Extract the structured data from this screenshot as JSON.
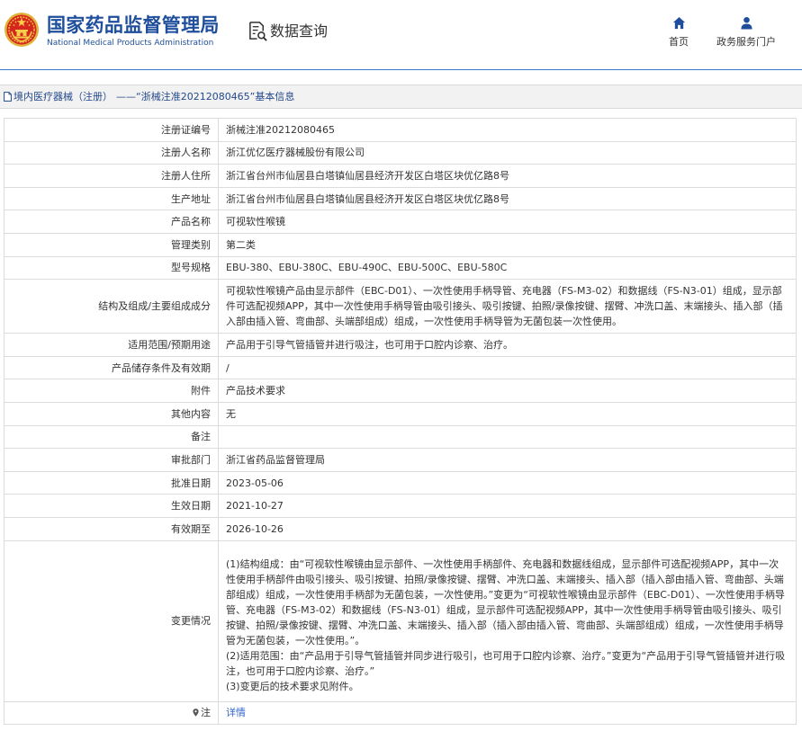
{
  "header": {
    "title": "国家药品监督管理局",
    "subtitle": "National Medical Products Administration",
    "query_label": "数据查询",
    "nav_home": "首页",
    "nav_portal": "政务服务门户",
    "brand_color": "#1f4f9c",
    "icons": [
      "national-emblem-logo",
      "search-document-icon",
      "home-icon",
      "user-icon"
    ]
  },
  "breadcrumb": {
    "icon": "document-icon",
    "category": "境内医疗器械（注册）",
    "title": "——“浙械注准20212080465”基本信息"
  },
  "record": {
    "fields": [
      {
        "label": "注册证编号",
        "value": "浙械注准20212080465"
      },
      {
        "label": "注册人名称",
        "value": "浙江优亿医疗器械股份有限公司"
      },
      {
        "label": "注册人住所",
        "value": "浙江省台州市仙居县白塔镇仙居县经济开发区白塔区块优亿路8号"
      },
      {
        "label": "生产地址",
        "value": "浙江省台州市仙居县白塔镇仙居县经济开发区白塔区块优亿路8号"
      },
      {
        "label": "产品名称",
        "value": "可视软性喉镜"
      },
      {
        "label": "管理类别",
        "value": "第二类"
      },
      {
        "label": "型号规格",
        "value": "EBU-380、EBU-380C、EBU-490C、EBU-500C、EBU-580C"
      },
      {
        "label": "结构及组成/主要组成成分",
        "value": "可视软性喉镜产品由显示部件（EBC-D01）、一次性使用手柄导管、充电器（FS-M3-02）和数据线（FS-N3-01）组成，显示部件可选配视频APP，其中一次性使用手柄导管由吸引接头、吸引按键、拍照/录像按键、摆臂、冲洗口盖、末端接头、插入部（插入部由插入管、弯曲部、头端部组成）组成，一次性使用手柄导管为无菌包装一次性使用。"
      },
      {
        "label": "适用范围/预期用途",
        "value": "产品用于引导气管插管并进行吸注，也可用于口腔内诊察、治疗。"
      },
      {
        "label": "产品储存条件及有效期",
        "value": "/"
      },
      {
        "label": "附件",
        "value": "产品技术要求"
      },
      {
        "label": "其他内容",
        "value": "无"
      },
      {
        "label": "备注",
        "value": ""
      },
      {
        "label": "审批部门",
        "value": "浙江省药品监督管理局"
      },
      {
        "label": "批准日期",
        "value": "2023-05-06"
      },
      {
        "label": "生效日期",
        "value": "2021-10-27"
      },
      {
        "label": "有效期至",
        "value": "2026-10-26"
      }
    ],
    "changes": {
      "label": "变更情况",
      "paragraphs": [
        "(1)结构组成：由“可视软性喉镜由显示部件、一次性使用手柄部件、充电器和数据线组成，显示部件可选配视频APP，其中一次性使用手柄部件由吸引接头、吸引按键、拍照/录像按键、摆臂、冲洗口盖、末端接头、插入部（插入部由插入管、弯曲部、头端部组成）组成，一次性使用手柄部为无菌包装，一次性使用。”变更为“可视软性喉镜由显示部件（EBC-D01）、一次性使用手柄导管、充电器（FS-M3-02）和数据线（FS-N3-01）组成，显示部件可选配视频APP，其中一次性使用手柄导管由吸引接头、吸引按键、拍照/录像按键、摆臂、冲洗口盖、末端接头、插入部（插入部由插入管、弯曲部、头端部组成）组成，一次性使用手柄导管为无菌包装，一次性使用。”。",
        "(2)适用范围：由“产品用于引导气管插管并同步进行吸引，也可用于口腔内诊察、治疗。”变更为“产品用于引导气管插管并进行吸注，也可用于口腔内诊察、治疗。”",
        "(3)变更后的技术要求见附件。"
      ]
    },
    "note": {
      "icon": "pin-icon",
      "label": "注",
      "link": "详情",
      "link_color": "#3366cc"
    }
  }
}
